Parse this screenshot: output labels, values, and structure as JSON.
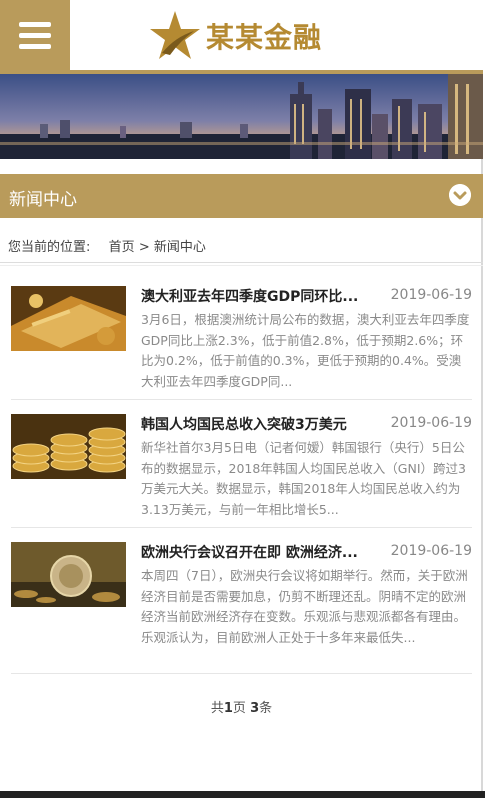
{
  "header": {
    "logo_text": "某某金融",
    "menu_icon": "hamburger-menu-icon"
  },
  "section": {
    "title": "新闻中心"
  },
  "breadcrumb": {
    "prefix": "您当前的位置:",
    "home": "首页",
    "sep": ">",
    "current": "新闻中心"
  },
  "news": [
    {
      "title": "澳大利亚去年四季度GDP同环比...",
      "date": "2019-06-19",
      "summary": "3月6日，根据澳洲统计局公布的数据，澳大利亚去年四季度GDP同比上涨2.3%，低于前值2.8%，低于预期2.6%；环比为0.2%，低于前值的0.3%，更低于预期的0.4%。受澳大利亚去年四季度GDP同..."
    },
    {
      "title": "韩国人均国民总收入突破3万美元",
      "date": "2019-06-19",
      "summary": "新华社首尔3月5日电（记者何嫒）韩国银行（央行）5日公布的数据显示，2018年韩国人均国民总收入（GNI）跨过3万美元大关。数据显示，韩国2018年人均国民总收入约为3.13万美元，与前一年相比增长5..."
    },
    {
      "title": "欧洲央行会议召开在即 欧洲经济...",
      "date": "2019-06-19",
      "summary": "本周四（7日），欧洲央行会议将如期举行。然而，关于欧洲经济目前是否需要加息，仍剪不断理还乱。阴晴不定的欧洲经济当前欧洲经济存在变数。乐观派与悲观派都各有理由。乐观派认为，目前欧洲人正处于十多年来最低失..."
    }
  ],
  "pager": {
    "pre": "共",
    "pages": "1",
    "mid": "页 ",
    "count": "3",
    "post": "条"
  },
  "colors": {
    "accent": "#b99b5b",
    "logo": "#b58a32"
  }
}
